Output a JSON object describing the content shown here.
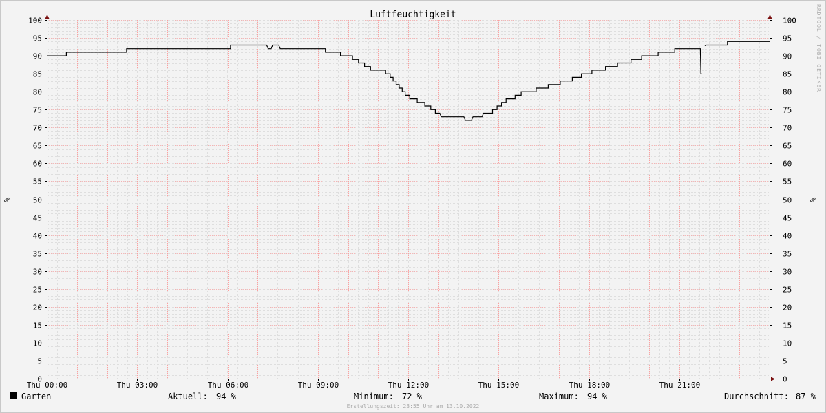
{
  "colors": {
    "line": "#000000",
    "minor_grid": "#dedede",
    "major_grid_x": "#ff9e9e",
    "major_grid_y": "#ff9e9e",
    "axis": "#000000",
    "arrow": "#7a1010",
    "legend_box": "#000000"
  },
  "vertical_label": "RRDTOOL / TOBI OETIKER",
  "footer": "Erstellungszeit: 23:55 Uhr am 13.10.2022",
  "legend": {
    "series_name": "Garten",
    "current_label": "Aktuell:",
    "current_value": "94 %",
    "min_label": "Minimum:",
    "min_value": "72 %",
    "max_label": "Maximum:",
    "max_value": "94 %",
    "avg_label": "Durchschnitt:",
    "avg_value": "87 %"
  },
  "chart_data": {
    "type": "line",
    "title": "Luftfeuchtigkeit",
    "xlabel": "",
    "ylabel": "%",
    "y_right_label": "%",
    "xlim": [
      0,
      24
    ],
    "ylim": [
      0,
      100
    ],
    "x_ticks": [
      {
        "x": 0,
        "label": "Thu 00:00"
      },
      {
        "x": 3,
        "label": "Thu 03:00"
      },
      {
        "x": 6,
        "label": "Thu 06:00"
      },
      {
        "x": 9,
        "label": "Thu 09:00"
      },
      {
        "x": 12,
        "label": "Thu 12:00"
      },
      {
        "x": 15,
        "label": "Thu 15:00"
      },
      {
        "x": 18,
        "label": "Thu 18:00"
      },
      {
        "x": 21,
        "label": "Thu 21:00"
      }
    ],
    "y_ticks": [
      0,
      5,
      10,
      15,
      20,
      25,
      30,
      35,
      40,
      45,
      50,
      55,
      60,
      65,
      70,
      75,
      80,
      85,
      90,
      95,
      100
    ],
    "grid": true,
    "series": [
      {
        "name": "Garten",
        "segments": [
          [
            [
              0.0,
              90
            ],
            [
              0.65,
              90
            ],
            [
              0.65,
              91
            ],
            [
              2.65,
              91
            ],
            [
              2.65,
              92
            ],
            [
              6.1,
              92
            ],
            [
              6.1,
              93
            ],
            [
              7.3,
              93
            ],
            [
              7.35,
              92
            ],
            [
              7.45,
              92
            ],
            [
              7.5,
              93
            ],
            [
              7.7,
              93
            ],
            [
              7.75,
              92
            ],
            [
              9.25,
              92
            ],
            [
              9.25,
              91
            ],
            [
              9.75,
              91
            ],
            [
              9.75,
              90
            ],
            [
              10.15,
              90
            ],
            [
              10.15,
              89
            ],
            [
              10.35,
              89
            ],
            [
              10.35,
              88
            ],
            [
              10.55,
              88
            ],
            [
              10.55,
              87
            ],
            [
              10.75,
              87
            ],
            [
              10.75,
              86
            ],
            [
              11.25,
              86
            ],
            [
              11.25,
              85
            ],
            [
              11.4,
              85
            ],
            [
              11.4,
              84
            ],
            [
              11.5,
              84
            ],
            [
              11.5,
              83
            ],
            [
              11.6,
              83
            ],
            [
              11.6,
              82
            ],
            [
              11.7,
              82
            ],
            [
              11.7,
              81
            ],
            [
              11.8,
              81
            ],
            [
              11.8,
              80
            ],
            [
              11.9,
              80
            ],
            [
              11.9,
              79
            ],
            [
              12.05,
              79
            ],
            [
              12.05,
              78
            ],
            [
              12.3,
              78
            ],
            [
              12.3,
              77
            ],
            [
              12.55,
              77
            ],
            [
              12.55,
              76
            ],
            [
              12.75,
              76
            ],
            [
              12.75,
              75
            ],
            [
              12.9,
              75
            ],
            [
              12.9,
              74
            ],
            [
              13.05,
              74
            ],
            [
              13.1,
              73
            ],
            [
              13.85,
              73
            ],
            [
              13.9,
              72
            ],
            [
              14.1,
              72
            ],
            [
              14.15,
              73
            ],
            [
              14.45,
              73
            ],
            [
              14.5,
              74
            ],
            [
              14.8,
              74
            ],
            [
              14.8,
              75
            ],
            [
              14.95,
              75
            ],
            [
              14.95,
              76
            ],
            [
              15.1,
              76
            ],
            [
              15.1,
              77
            ],
            [
              15.25,
              77
            ],
            [
              15.25,
              78
            ],
            [
              15.55,
              78
            ],
            [
              15.55,
              79
            ],
            [
              15.75,
              79
            ],
            [
              15.75,
              80
            ],
            [
              16.25,
              80
            ],
            [
              16.25,
              81
            ],
            [
              16.65,
              81
            ],
            [
              16.65,
              82
            ],
            [
              17.05,
              82
            ],
            [
              17.05,
              83
            ],
            [
              17.45,
              83
            ],
            [
              17.45,
              84
            ],
            [
              17.75,
              84
            ],
            [
              17.75,
              85
            ],
            [
              18.1,
              85
            ],
            [
              18.1,
              86
            ],
            [
              18.55,
              86
            ],
            [
              18.55,
              87
            ],
            [
              18.95,
              87
            ],
            [
              18.95,
              88
            ],
            [
              19.4,
              88
            ],
            [
              19.4,
              89
            ],
            [
              19.75,
              89
            ],
            [
              19.75,
              90
            ],
            [
              20.3,
              90
            ],
            [
              20.3,
              91
            ],
            [
              20.85,
              91
            ],
            [
              20.85,
              92
            ],
            [
              21.7,
              92
            ],
            [
              21.72,
              85
            ],
            [
              21.75,
              85
            ]
          ],
          [
            [
              21.85,
              92.8
            ],
            [
              21.9,
              93
            ],
            [
              22.6,
              93
            ],
            [
              22.6,
              94
            ],
            [
              24.0,
              94
            ]
          ]
        ]
      }
    ]
  }
}
